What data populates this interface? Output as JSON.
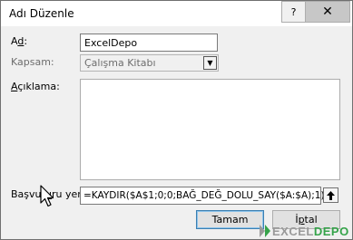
{
  "window": {
    "title": "Adı Düzenle",
    "help_glyph": "?",
    "close_glyph": "✕"
  },
  "form": {
    "name_label_mn": "d",
    "name_label_rest": "A",
    "name_value": "ExcelDepo",
    "scope_label": "Kapsam:",
    "scope_value": "Çalışma Kitabı",
    "comment_label_mn": "A",
    "comment_label_rest": "çıklama:",
    "refers_label_pre": "Başvur",
    "refers_label_mn": "u",
    "refers_label_post": "ru yeri:",
    "refers_value": "=KAYDIR($A$1;0;0;BAĞ_DEĞ_DOLU_SAY($A:$A);1)"
  },
  "buttons": {
    "ok_label": "Tamam",
    "cancel_pre": "İ",
    "cancel_mn": "p",
    "cancel_post": "tal"
  },
  "watermark": {
    "part1": "EXCEL",
    "part2": "DEPO"
  }
}
